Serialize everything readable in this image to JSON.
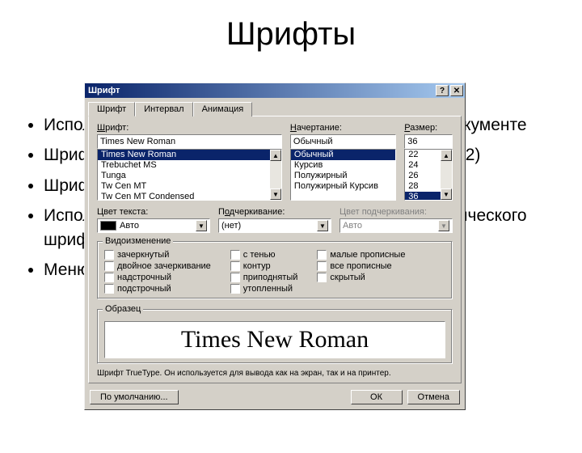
{
  "slide": {
    "title": "Шрифты",
    "bullets": [
      "Используйте не более трех различных шрифтов в документе",
      "Шрифт Times New Roman для основного текста (10-12)",
      "Шрифт Arial для заголовков",
      "Используйте не более одного полужирного или италического шрифта в строке",
      "Меню Формат/Шрифт"
    ]
  },
  "dialog": {
    "title": "Шрифт",
    "tabs": {
      "font": "Шрифт",
      "interval": "Интервал",
      "animation": "Анимация"
    },
    "font": {
      "label": "Шрифт:",
      "value": "Times New Roman",
      "list": [
        "Times New Roman",
        "Trebuchet MS",
        "Tunga",
        "Tw Cen MT",
        "Tw Cen MT Condensed"
      ]
    },
    "style": {
      "label": "Начертание:",
      "value": "Обычный",
      "list": [
        "Обычный",
        "Курсив",
        "Полужирный",
        "Полужирный Курсив"
      ]
    },
    "size": {
      "label": "Размер:",
      "value": "36",
      "list": [
        "22",
        "24",
        "26",
        "28",
        "36"
      ]
    },
    "textcolor": {
      "label": "Цвет текста:",
      "value": "Авто"
    },
    "underline": {
      "label": "Подчеркивание:",
      "value": "(нет)"
    },
    "underlinecolor": {
      "label": "Цвет подчеркивания:",
      "value": "Авто"
    },
    "effects": {
      "label": "Видоизменение",
      "col1": [
        "зачеркнутый",
        "двойное зачеркивание",
        "надстрочный",
        "подстрочный"
      ],
      "col2": [
        "с тенью",
        "контур",
        "приподнятый",
        "утопленный"
      ],
      "col3": [
        "малые прописные",
        "все прописные",
        "скрытый"
      ]
    },
    "preview": {
      "label": "Образец",
      "text": "Times New Roman"
    },
    "desc": "Шрифт TrueType. Он используется для вывода как на экран, так и на принтер.",
    "buttons": {
      "default": "По умолчанию...",
      "ok": "ОК",
      "cancel": "Отмена"
    }
  }
}
